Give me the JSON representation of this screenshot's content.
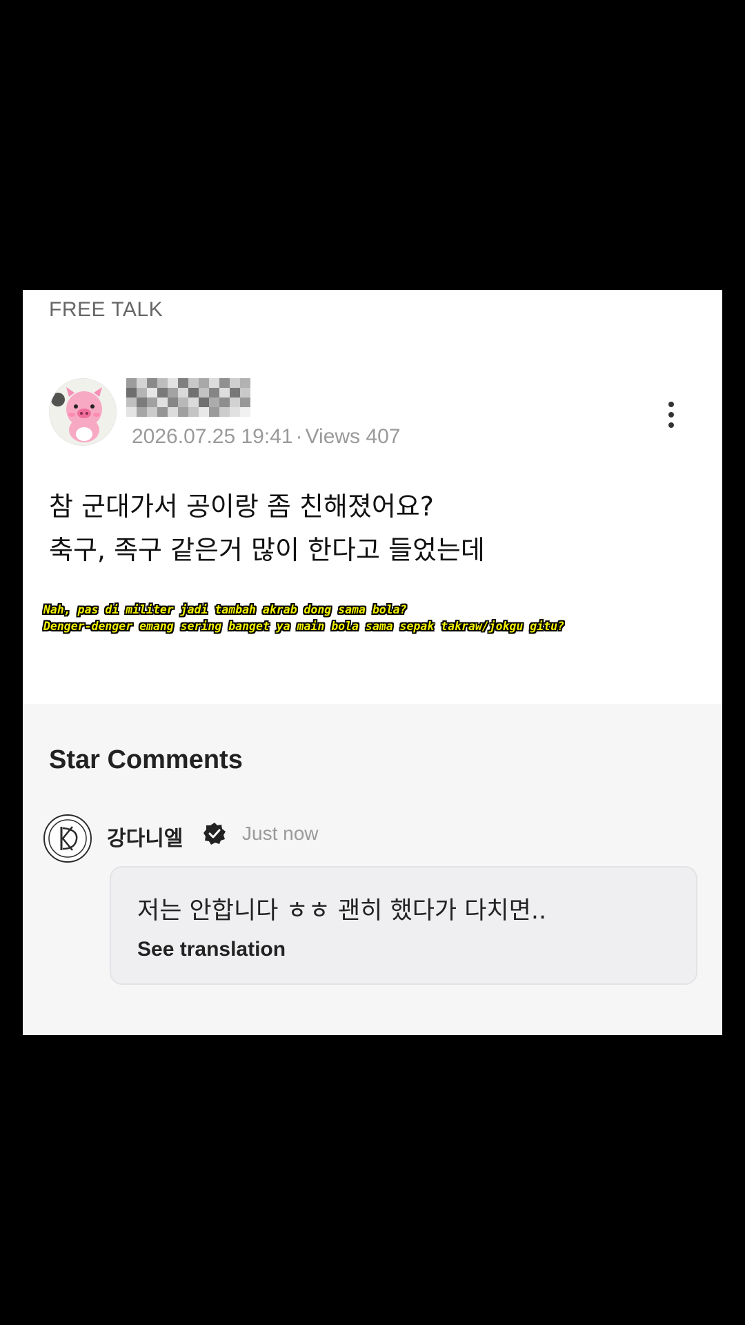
{
  "post": {
    "board_label": "FREE TALK",
    "date": "2026.07.25 19:41",
    "separator": "·",
    "views": "Views 407",
    "body_lines": [
      "참 군대가서 공이랑 좀 친해졌어요?",
      "축구, 족구 같은거 많이 한다고 들었는데"
    ],
    "subtitle_lines": [
      "Nah, pas di militer jadi tambah akrab dong sama bola?",
      "Denger-denger emang sering banget ya main bola sama sepak takraw/jokgu gitu?"
    ]
  },
  "comments": {
    "title": "Star Comments",
    "items": [
      {
        "author": "강다니엘",
        "time": "Just now",
        "text": "저는 안합니다 ㅎㅎ 괜히 했다가 다치면..",
        "translate_label": "See translation"
      }
    ]
  },
  "icons": {
    "more": "more-vertical-icon",
    "verified": "verified-badge-icon"
  },
  "colors": {
    "subtitle_fill": "#f4f200",
    "subtitle_outline": "#000000",
    "meta_text": "#9a9a9a",
    "comments_bg": "#f6f6f7"
  }
}
